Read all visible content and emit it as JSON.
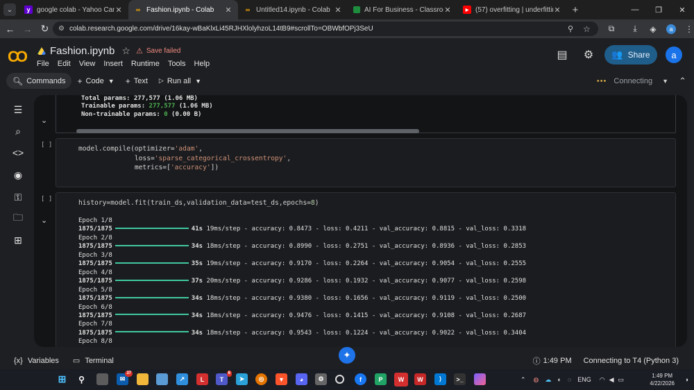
{
  "browser": {
    "tabs": [
      {
        "title": "google colab - Yahoo Canada S",
        "favicon": "yahoo",
        "active": false
      },
      {
        "title": "Fashion.ipynb - Colab",
        "favicon": "colab",
        "active": true
      },
      {
        "title": "Untitled14.ipynb - Colab",
        "favicon": "colab",
        "active": false
      },
      {
        "title": "AI For Business - Classroom",
        "favicon": "classroom",
        "active": false
      },
      {
        "title": "(57) overfitting | underfitting | M",
        "favicon": "youtube",
        "active": false
      }
    ],
    "new_tab": "+",
    "url": "colab.research.google.com/drive/16kay-wBaKlxLi45RJHXlolyhzoL14tB9#scrollTo=OBWbfOPj3SeU",
    "profile_initial": "a"
  },
  "colab": {
    "logo": "CO",
    "notebook_name": "Fashion.ipynb",
    "save_status": "Save failed",
    "menu": [
      "File",
      "Edit",
      "View",
      "Insert",
      "Runtime",
      "Tools",
      "Help"
    ],
    "share_label": "Share",
    "account_initial": "a",
    "toolbar": {
      "commands": "Commands",
      "code": "Code",
      "text": "Text",
      "run_all": "Run all",
      "connection": "Connecting"
    }
  },
  "cells": {
    "summary_output": {
      "total_params": "Total params: 277,577 (1.06 MB)",
      "trainable_label": "Trainable params: ",
      "trainable_num": "277,577",
      "trainable_size": " (1.06 MB)",
      "nontrainable_label": "Non-trainable params: ",
      "nontrainable_num": "0",
      "nontrainable_size": " (0.00 B)"
    },
    "compile": {
      "run_label": "[ ]",
      "line1_a": "model.compile(optimizer=",
      "line1_s": "'adam'",
      "line1_b": ",",
      "line2_a": "              loss=",
      "line2_s": "'sparse_categorical_crossentropy'",
      "line2_b": ",",
      "line3_a": "              metrics=[",
      "line3_s": "'accuracy'",
      "line3_b": "])"
    },
    "fit": {
      "run_label": "[ ]",
      "code_a": "history=model.fit(train_ds,validation_data=test_ds,epochs=",
      "code_n": "8",
      "code_b": ")",
      "epochs": [
        {
          "label": "Epoch 1/8",
          "steps": "1875/1875",
          "time": "41s",
          "per_step": " 19ms/step - accuracy: 0.8473 - loss: 0.4211 - val_accuracy: 0.8815 - val_loss: 0.3318"
        },
        {
          "label": "Epoch 2/8",
          "steps": "1875/1875",
          "time": "34s",
          "per_step": " 18ms/step - accuracy: 0.8990 - loss: 0.2751 - val_accuracy: 0.8936 - val_loss: 0.2853"
        },
        {
          "label": "Epoch 3/8",
          "steps": "1875/1875",
          "time": "35s",
          "per_step": " 19ms/step - accuracy: 0.9170 - loss: 0.2264 - val_accuracy: 0.9054 - val_loss: 0.2555"
        },
        {
          "label": "Epoch 4/8",
          "steps": "1875/1875",
          "time": "37s",
          "per_step": " 20ms/step - accuracy: 0.9286 - loss: 0.1932 - val_accuracy: 0.9077 - val_loss: 0.2598"
        },
        {
          "label": "Epoch 5/8",
          "steps": "1875/1875",
          "time": "34s",
          "per_step": " 18ms/step - accuracy: 0.9380 - loss: 0.1656 - val_accuracy: 0.9119 - val_loss: 0.2500"
        },
        {
          "label": "Epoch 6/8",
          "steps": "1875/1875",
          "time": "34s",
          "per_step": " 18ms/step - accuracy: 0.9476 - loss: 0.1415 - val_accuracy: 0.9108 - val_loss: 0.2687"
        },
        {
          "label": "Epoch 7/8",
          "steps": "1875/1875",
          "time": "34s",
          "per_step": " 18ms/step - accuracy: 0.9543 - loss: 0.1224 - val_accuracy: 0.9022 - val_loss: 0.3404"
        }
      ],
      "trailing": "Epoch 8/8"
    }
  },
  "statusbar": {
    "variables": "Variables",
    "terminal": "Terminal",
    "exec_time": "1:49 PM",
    "runtime": "Connecting to T4 (Python 3)"
  },
  "taskbar": {
    "badges": {
      "mail": "37",
      "teams": "6"
    },
    "lang": "ENG",
    "time": "1:49 PM",
    "date": "4/22/2026"
  },
  "colors": {
    "accent": "#1a73e8",
    "progress": "#40c9a2",
    "warning": "#f28b82",
    "brand": "#f9ab00"
  }
}
